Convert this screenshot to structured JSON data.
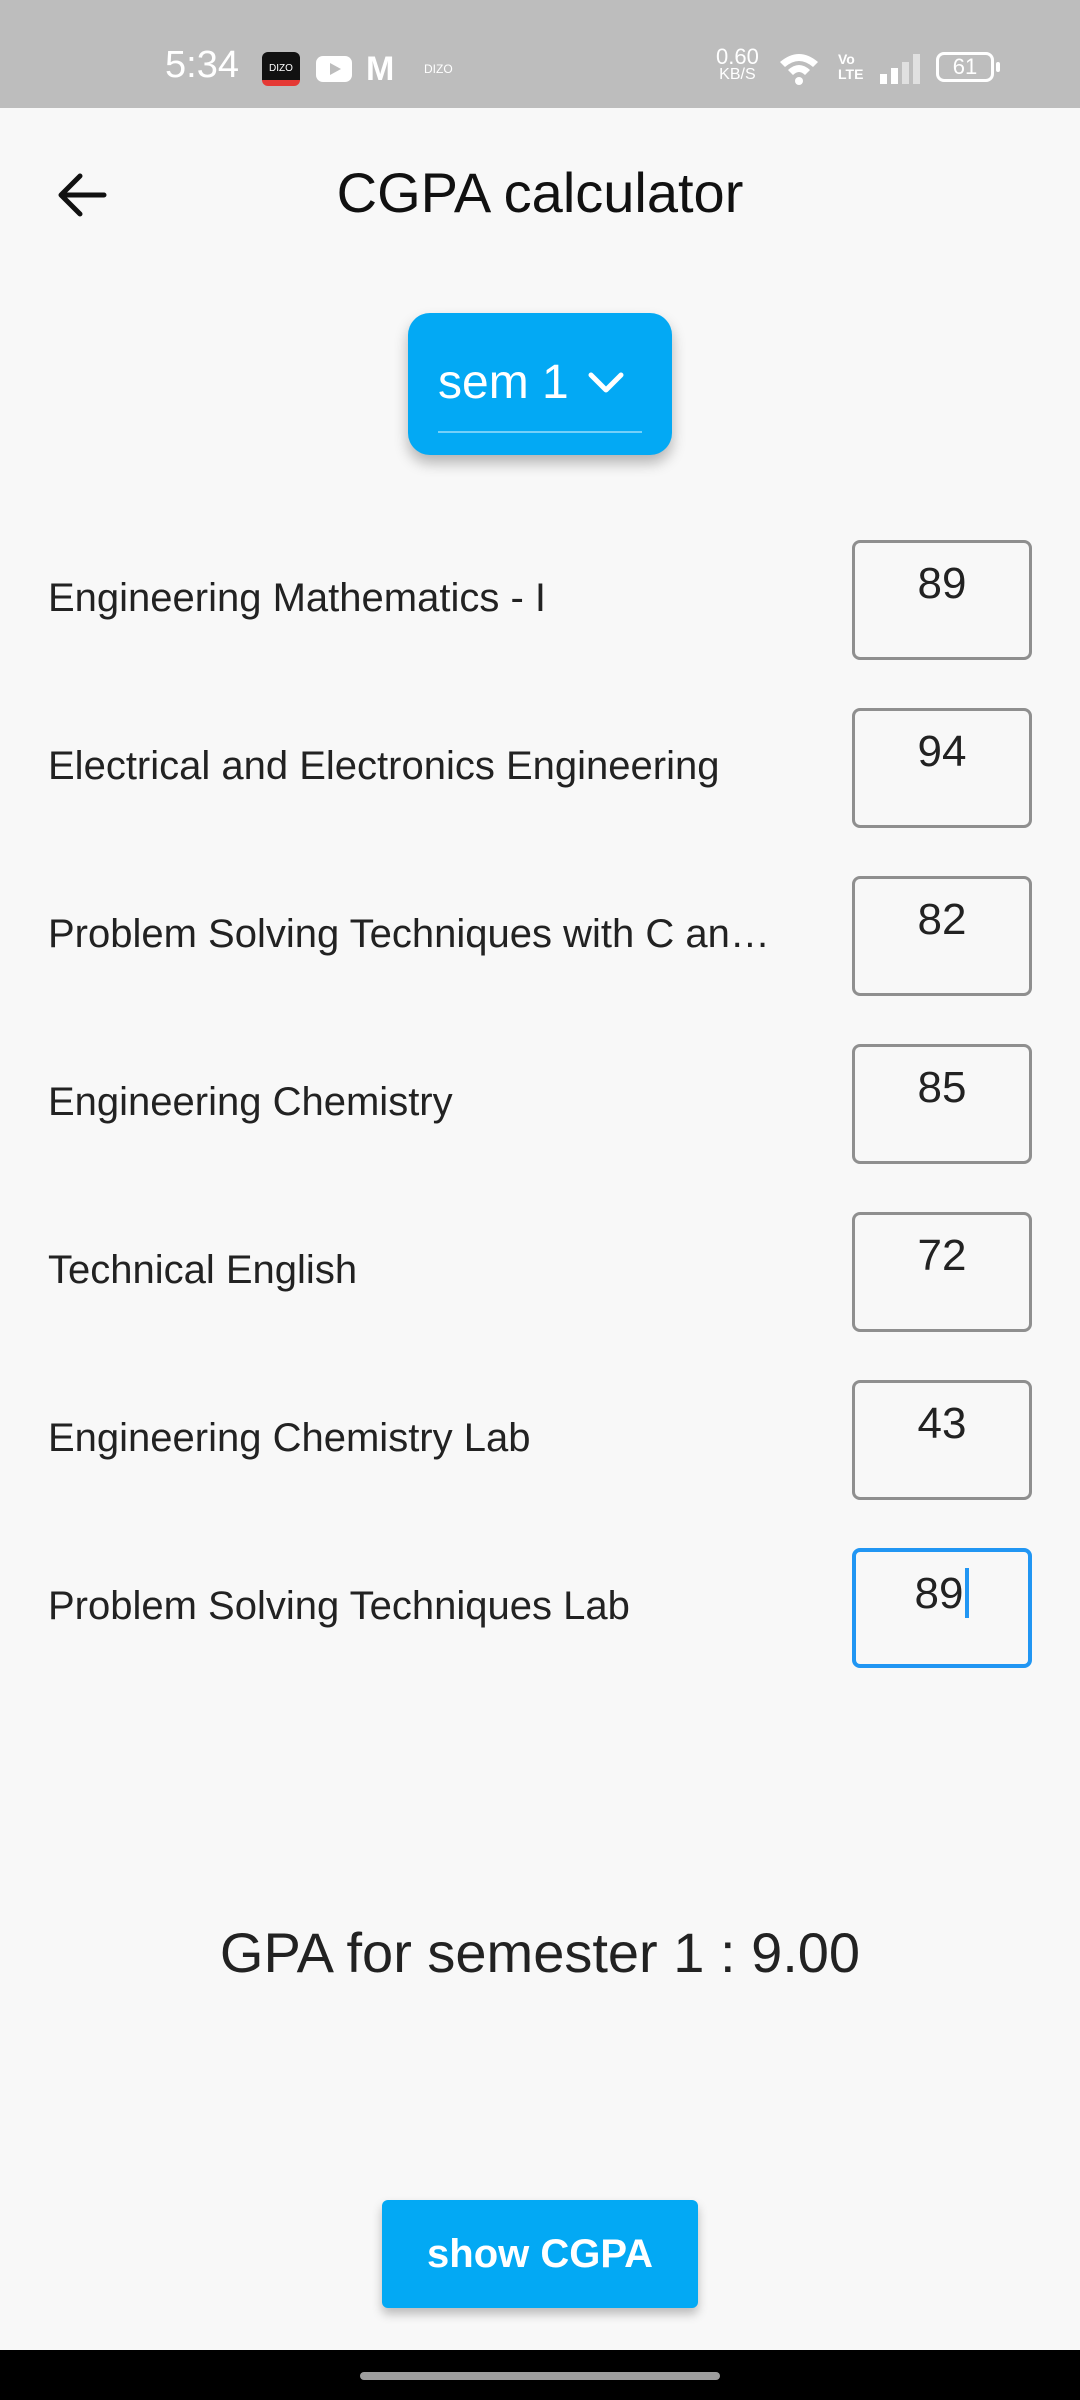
{
  "status_bar": {
    "time": "5:34",
    "dizo_label": "DIZO",
    "dizo_label2": "DIZO",
    "net_speed_value": "0.60",
    "net_speed_unit": "KB/S",
    "volte_label": "Vo\nLTE",
    "battery": "61"
  },
  "app_bar": {
    "title": "CGPA calculator"
  },
  "semester_dropdown": {
    "selected": "sem 1"
  },
  "subjects": [
    {
      "name": "Engineering Mathematics - I",
      "mark": "89"
    },
    {
      "name": "Electrical and Electronics Engineering",
      "mark": "94"
    },
    {
      "name": "Problem Solving Techniques with C an…",
      "mark": "82"
    },
    {
      "name": "Engineering Chemistry",
      "mark": "85"
    },
    {
      "name": "Technical English",
      "mark": "72"
    },
    {
      "name": "Engineering Chemistry Lab",
      "mark": "43"
    },
    {
      "name": "Problem Solving Techniques Lab",
      "mark": "89"
    }
  ],
  "result": {
    "gpa_text": "GPA for semester 1 : 9.00"
  },
  "actions": {
    "show_cgpa_label": "show CGPA"
  },
  "colors": {
    "accent": "#03a9f4",
    "focus": "#2196f3",
    "background": "#f8f8f8",
    "status_bar": "#bdbdbd"
  }
}
